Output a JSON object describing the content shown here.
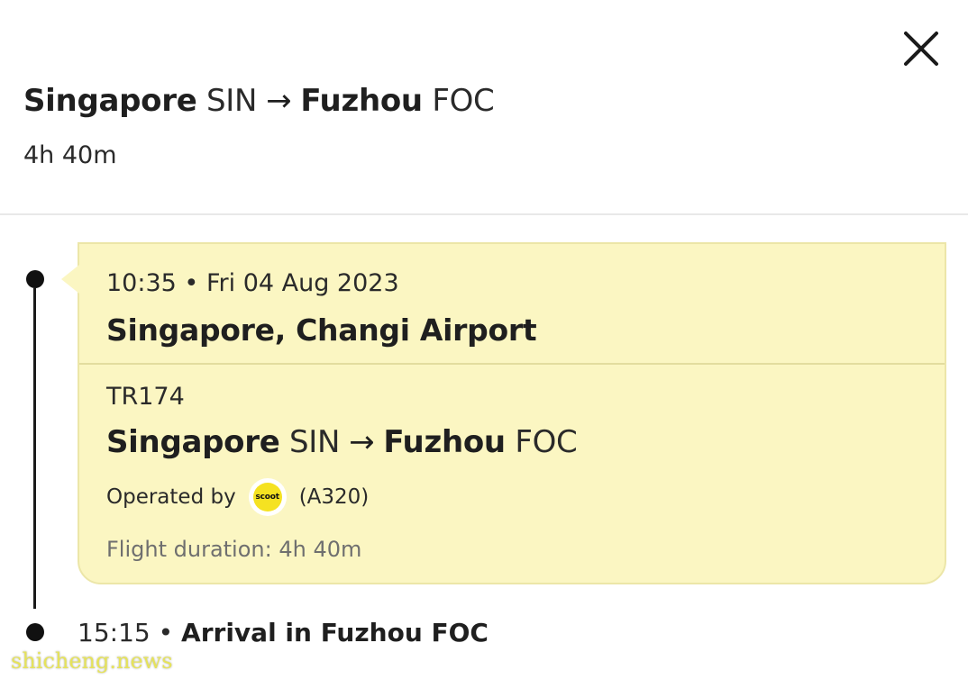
{
  "header": {
    "close_icon": "close-icon",
    "origin_city": "Singapore",
    "origin_code": "SIN",
    "arrow": "→",
    "dest_city": "Fuzhou",
    "dest_code": "FOC",
    "duration": "4h 40m"
  },
  "departure": {
    "time": "10:35",
    "separator": "•",
    "date": "Fri 04 Aug 2023",
    "airport": "Singapore, Changi Airport"
  },
  "segment": {
    "flight_number": "TR174",
    "origin_city": "Singapore",
    "origin_code": "SIN",
    "arrow": "→",
    "dest_city": "Fuzhou",
    "dest_code": "FOC",
    "operated_by_label": "Operated by",
    "airline_logo_text": "scoot",
    "aircraft": "(A320)",
    "duration_text": "Flight duration: 4h 40m"
  },
  "arrival": {
    "time": "15:15",
    "separator": "•",
    "label": "Arrival in Fuzhou FOC"
  },
  "watermark": {
    "text": "shicheng.news"
  },
  "colors": {
    "card_background": "#fbf6c2",
    "card_border": "#ece6a8",
    "airline_logo_yellow": "#f5e221",
    "timeline": "#111111"
  }
}
